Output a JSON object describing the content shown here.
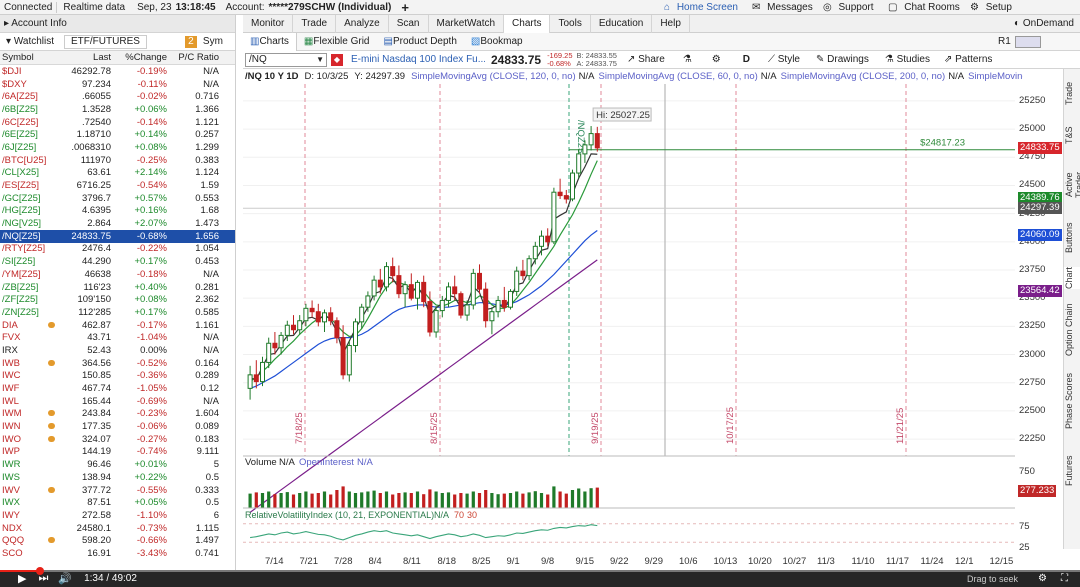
{
  "topbar": {
    "connected": "Connected",
    "realtime": "Realtime data",
    "date": "Sep, 23",
    "time": "13:18:45",
    "account_label": "Account:",
    "account": "*****279SCHW (Individual)",
    "plus": "+",
    "home_screen": "Home Screen",
    "messages": "Messages",
    "support": "Support",
    "chat_rooms": "Chat Rooms",
    "setup": "Setup",
    "ondemand": "OnDemand"
  },
  "menu": [
    "Monitor",
    "Trade",
    "Analyze",
    "Scan",
    "MarketWatch",
    "Charts",
    "Tools",
    "Education",
    "Help"
  ],
  "left": {
    "account_info": "Account Info",
    "watchlist_tab": "Watchlist",
    "etf_tab": "ETF/FUTURES",
    "sym_tab": "Sym",
    "badge": "2",
    "headers": {
      "symbol": "Symbol",
      "last": "Last",
      "change": "%Change",
      "pc": "P/C Ratio"
    },
    "rows": [
      {
        "sym": "$DJI",
        "last": "46292.78",
        "chg": "-0.19%",
        "pc": "N/A",
        "dir": "red",
        "icon": false
      },
      {
        "sym": "$DXY",
        "last": "97.234",
        "chg": "-0.11%",
        "pc": "N/A",
        "dir": "red",
        "icon": false
      },
      {
        "sym": "/6A[Z25]",
        "last": ".66055",
        "chg": "-0.02%",
        "pc": "0.716",
        "dir": "red",
        "icon": false
      },
      {
        "sym": "/6B[Z25]",
        "last": "1.3528",
        "chg": "+0.06%",
        "pc": "1.366",
        "dir": "grn",
        "icon": false
      },
      {
        "sym": "/6C[Z25]",
        "last": ".72540",
        "chg": "-0.14%",
        "pc": "1.121",
        "dir": "red",
        "icon": false
      },
      {
        "sym": "/6E[Z25]",
        "last": "1.18710",
        "chg": "+0.14%",
        "pc": "0.257",
        "dir": "grn",
        "icon": false
      },
      {
        "sym": "/6J[Z25]",
        "last": ".0068310",
        "chg": "+0.08%",
        "pc": "1.299",
        "dir": "grn",
        "icon": false
      },
      {
        "sym": "/BTC[U25]",
        "last": "111970",
        "chg": "-0.25%",
        "pc": "0.383",
        "dir": "red",
        "icon": false
      },
      {
        "sym": "/CL[X25]",
        "last": "63.61",
        "chg": "+2.14%",
        "pc": "1.124",
        "dir": "grn",
        "icon": false
      },
      {
        "sym": "/ES[Z25]",
        "last": "6716.25",
        "chg": "-0.54%",
        "pc": "1.59",
        "dir": "red",
        "icon": false
      },
      {
        "sym": "/GC[Z25]",
        "last": "3796.7",
        "chg": "+0.57%",
        "pc": "0.553",
        "dir": "grn",
        "icon": false
      },
      {
        "sym": "/HG[Z25]",
        "last": "4.6395",
        "chg": "+0.16%",
        "pc": "1.68",
        "dir": "grn",
        "icon": false
      },
      {
        "sym": "/NG[V25]",
        "last": "2.864",
        "chg": "+2.07%",
        "pc": "1.473",
        "dir": "grn",
        "icon": false
      },
      {
        "sym": "/NQ[Z25]",
        "last": "24833.75",
        "chg": "-0.68%",
        "pc": "1.656",
        "dir": "red",
        "icon": false,
        "selected": true
      },
      {
        "sym": "/RTY[Z25]",
        "last": "2476.4",
        "chg": "-0.22%",
        "pc": "1.054",
        "dir": "red",
        "icon": false
      },
      {
        "sym": "/SI[Z25]",
        "last": "44.290",
        "chg": "+0.17%",
        "pc": "0.453",
        "dir": "grn",
        "icon": false
      },
      {
        "sym": "/YM[Z25]",
        "last": "46638",
        "chg": "-0.18%",
        "pc": "N/A",
        "dir": "red",
        "icon": false
      },
      {
        "sym": "/ZB[Z25]",
        "last": "116'23",
        "chg": "+0.40%",
        "pc": "0.281",
        "dir": "grn",
        "icon": false
      },
      {
        "sym": "/ZF[Z25]",
        "last": "109'150",
        "chg": "+0.08%",
        "pc": "2.362",
        "dir": "grn",
        "icon": false
      },
      {
        "sym": "/ZN[Z25]",
        "last": "112'285",
        "chg": "+0.17%",
        "pc": "0.585",
        "dir": "grn",
        "icon": false
      },
      {
        "sym": "DIA",
        "last": "462.87",
        "chg": "-0.17%",
        "pc": "1.161",
        "dir": "red",
        "icon": true
      },
      {
        "sym": "FVX",
        "last": "43.71",
        "chg": "-1.04%",
        "pc": "N/A",
        "dir": "red",
        "icon": false
      },
      {
        "sym": "IRX",
        "last": "52.43",
        "chg": "0.00%",
        "pc": "N/A",
        "dir": "none",
        "icon": false
      },
      {
        "sym": "IWB",
        "last": "364.56",
        "chg": "-0.52%",
        "pc": "0.164",
        "dir": "red",
        "icon": true
      },
      {
        "sym": "IWC",
        "last": "150.85",
        "chg": "-0.36%",
        "pc": "0.289",
        "dir": "red",
        "icon": false
      },
      {
        "sym": "IWF",
        "last": "467.74",
        "chg": "-1.05%",
        "pc": "0.12",
        "dir": "red",
        "icon": false
      },
      {
        "sym": "IWL",
        "last": "165.44",
        "chg": "-0.69%",
        "pc": "N/A",
        "dir": "red",
        "icon": false
      },
      {
        "sym": "IWM",
        "last": "243.84",
        "chg": "-0.23%",
        "pc": "1.604",
        "dir": "red",
        "icon": true
      },
      {
        "sym": "IWN",
        "last": "177.35",
        "chg": "-0.06%",
        "pc": "0.089",
        "dir": "red",
        "icon": true
      },
      {
        "sym": "IWO",
        "last": "324.07",
        "chg": "-0.27%",
        "pc": "0.183",
        "dir": "red",
        "icon": true
      },
      {
        "sym": "IWP",
        "last": "144.19",
        "chg": "-0.74%",
        "pc": "9.111",
        "dir": "red",
        "icon": false
      },
      {
        "sym": "IWR",
        "last": "96.46",
        "chg": "+0.01%",
        "pc": "5",
        "dir": "grn",
        "icon": false
      },
      {
        "sym": "IWS",
        "last": "138.94",
        "chg": "+0.22%",
        "pc": "0.5",
        "dir": "grn",
        "icon": false
      },
      {
        "sym": "IWV",
        "last": "377.72",
        "chg": "-0.55%",
        "pc": "0.333",
        "dir": "red",
        "icon": true
      },
      {
        "sym": "IWX",
        "last": "87.51",
        "chg": "+0.05%",
        "pc": "0.5",
        "dir": "grn",
        "icon": false
      },
      {
        "sym": "IWY",
        "last": "272.58",
        "chg": "-1.10%",
        "pc": "6",
        "dir": "red",
        "icon": false
      },
      {
        "sym": "NDX",
        "last": "24580.1",
        "chg": "-0.73%",
        "pc": "1.115",
        "dir": "red",
        "icon": false
      },
      {
        "sym": "QQQ",
        "last": "598.20",
        "chg": "-0.66%",
        "pc": "1.497",
        "dir": "red",
        "icon": true
      },
      {
        "sym": "SCO",
        "last": "16.91",
        "chg": "-3.43%",
        "pc": "0.741",
        "dir": "red",
        "icon": false
      }
    ]
  },
  "chart_tabs": {
    "charts": "Charts",
    "flex": "Flexible Grid",
    "depth": "Product Depth",
    "bookmap": "Bookmap",
    "r1": "R1"
  },
  "chart_toolbar": {
    "symbol": "/NQ",
    "description": "E-mini Nasdaq 100 Index Fu...",
    "price": "24833.75",
    "chg": "-169.25",
    "chgpct": "-0.68%",
    "bid": "B: 24833.55",
    "ask": "A: 24833.75",
    "share": "Share",
    "timeframe": "D",
    "style": "Style",
    "drawings": "Drawings",
    "studies": "Studies",
    "patterns": "Patterns"
  },
  "studybar": {
    "period": "/NQ 10 Y 1D",
    "date": "D: 10/3/25",
    "yval": "Y: 24297.39",
    "sma1": "SimpleMovingAvg (CLOSE, 120, 0, no)",
    "sma1v": "N/A",
    "sma2": "SimpleMovingAvg (CLOSE, 60, 0, no)",
    "sma2v": "N/A",
    "sma3": "SimpleMovingAvg (CLOSE, 200, 0, no)",
    "sma3v": "N/A",
    "sma4": "SimpleMovingAvg ..."
  },
  "chart_data": {
    "type": "candlestick",
    "price_axis": [
      "25250",
      "25000",
      "24750",
      "24500",
      "24250",
      "24000",
      "23750",
      "23500",
      "23250",
      "23000",
      "22750",
      "22500",
      "22250"
    ],
    "ylim": [
      22100,
      25400
    ],
    "price_tags": [
      {
        "value": "24833.75",
        "color": "#d7262c"
      },
      {
        "value": "24389.76",
        "color": "#1d8a2b"
      },
      {
        "value": "24297.39",
        "color": "#555555"
      },
      {
        "value": "24060.09",
        "color": "#1e4fd6"
      },
      {
        "value": "23564.42",
        "color": "#7a1e8a"
      }
    ],
    "hline_label": "$24817.23",
    "hline_value": 24817.23,
    "hi_label": "Hi: 25027.25",
    "date_markers": [
      "7/18/25",
      "8/15/25",
      "9/19/25",
      "10/17/25",
      "11/21/25"
    ],
    "expiry_marker": "/NQZ25",
    "x_ticks": [
      "7/14",
      "7/21",
      "7/28",
      "8/4",
      "8/11",
      "8/18",
      "8/25",
      "9/1",
      "9/8",
      "9/15",
      "9/22",
      "9/29",
      "10/6",
      "10/13",
      "10/20",
      "10/27",
      "11/3",
      "11/10",
      "11/17",
      "11/24",
      "12/1",
      "12/15"
    ],
    "volume_label": "Volume",
    "volume_na": "N/A",
    "oi_label": "OpenInterest",
    "oi_na": "N/A",
    "volume_axis": "750",
    "volume_tag": "277.233",
    "rvi_label": "RelativeVolatilityIndex (10, 21, EXPONENTIAL)",
    "rvi_na": "N/A",
    "rvi_70": "70",
    "rvi_30": "30",
    "rvi_axis": [
      "75",
      "25"
    ],
    "candles": [
      [
        22700,
        22900,
        22600,
        22820
      ],
      [
        22820,
        22950,
        22700,
        22760
      ],
      [
        22760,
        22980,
        22720,
        22930
      ],
      [
        22930,
        23150,
        22880,
        23100
      ],
      [
        23100,
        23200,
        23000,
        23060
      ],
      [
        23060,
        23200,
        23000,
        23170
      ],
      [
        23170,
        23300,
        23120,
        23260
      ],
      [
        23260,
        23350,
        23180,
        23220
      ],
      [
        23220,
        23350,
        23180,
        23300
      ],
      [
        23300,
        23450,
        23250,
        23410
      ],
      [
        23410,
        23480,
        23330,
        23380
      ],
      [
        23380,
        23450,
        23250,
        23290
      ],
      [
        23290,
        23400,
        23200,
        23370
      ],
      [
        23370,
        23420,
        23260,
        23300
      ],
      [
        23300,
        23330,
        23100,
        23150
      ],
      [
        23150,
        23260,
        22780,
        22820
      ],
      [
        22820,
        23120,
        22760,
        23080
      ],
      [
        23080,
        23320,
        23020,
        23290
      ],
      [
        23290,
        23450,
        23230,
        23420
      ],
      [
        23420,
        23560,
        23380,
        23520
      ],
      [
        23520,
        23700,
        23480,
        23660
      ],
      [
        23660,
        23760,
        23540,
        23600
      ],
      [
        23600,
        23820,
        23560,
        23780
      ],
      [
        23780,
        23860,
        23640,
        23700
      ],
      [
        23700,
        23790,
        23500,
        23540
      ],
      [
        23540,
        23650,
        23420,
        23620
      ],
      [
        23620,
        23720,
        23480,
        23500
      ],
      [
        23500,
        23660,
        23400,
        23640
      ],
      [
        23640,
        23700,
        23420,
        23470
      ],
      [
        23470,
        23560,
        23160,
        23200
      ],
      [
        23200,
        23430,
        23150,
        23390
      ],
      [
        23390,
        23520,
        23330,
        23480
      ],
      [
        23480,
        23640,
        23420,
        23600
      ],
      [
        23600,
        23700,
        23480,
        23540
      ],
      [
        23540,
        23560,
        23320,
        23350
      ],
      [
        23350,
        23480,
        23300,
        23440
      ],
      [
        23440,
        23760,
        23400,
        23720
      ],
      [
        23720,
        23800,
        23540,
        23580
      ],
      [
        23580,
        23640,
        23240,
        23300
      ],
      [
        23300,
        23420,
        23180,
        23380
      ],
      [
        23380,
        23520,
        23330,
        23480
      ],
      [
        23480,
        23600,
        23380,
        23420
      ],
      [
        23420,
        23580,
        23400,
        23560
      ],
      [
        23560,
        23780,
        23520,
        23740
      ],
      [
        23740,
        23840,
        23660,
        23700
      ],
      [
        23700,
        23880,
        23660,
        23850
      ],
      [
        23850,
        24000,
        23800,
        23960
      ],
      [
        23960,
        24100,
        23880,
        24050
      ],
      [
        24050,
        24120,
        23960,
        24000
      ],
      [
        24000,
        24480,
        23980,
        24440
      ],
      [
        24440,
        24560,
        24380,
        24410
      ],
      [
        24410,
        24460,
        24340,
        24380
      ],
      [
        24380,
        24640,
        24360,
        24610
      ],
      [
        24610,
        24820,
        24560,
        24780
      ],
      [
        24780,
        24900,
        24700,
        24860
      ],
      [
        24860,
        25027,
        24810,
        24960
      ],
      [
        24960,
        25020,
        24800,
        24833
      ]
    ],
    "sma_fast": [
      22760,
      22800,
      22850,
      22900,
      22960,
      23010,
      23070,
      23120,
      23180,
      23230,
      23280,
      23320,
      23340,
      23320,
      23260,
      23200,
      23160,
      23170,
      23230,
      23320,
      23420,
      23520,
      23600,
      23650,
      23640,
      23620,
      23590,
      23570,
      23560,
      23490,
      23440,
      23430,
      23450,
      23480,
      23480,
      23460,
      23480,
      23520,
      23500,
      23440,
      23410,
      23410,
      23440,
      23500,
      23570,
      23640,
      23720,
      23800,
      23880,
      23960,
      24060,
      24150,
      24240,
      24350,
      24470,
      24600,
      24720
    ],
    "sma_mid": [
      22700,
      22720,
      22750,
      22780,
      22810,
      22850,
      22890,
      22930,
      22970,
      23010,
      23050,
      23090,
      23120,
      23140,
      23150,
      23150,
      23150,
      23160,
      23180,
      23210,
      23250,
      23290,
      23330,
      23370,
      23400,
      23420,
      23430,
      23440,
      23440,
      23430,
      23420,
      23420,
      23420,
      23430,
      23440,
      23440,
      23450,
      23460,
      23460,
      23450,
      23440,
      23440,
      23450,
      23470,
      23500,
      23530,
      23570,
      23610,
      23660,
      23710,
      23770,
      23830,
      23890,
      23950,
      24010,
      24060,
      24100
    ],
    "sma_slow": [
      21600,
      21640,
      21680,
      21720,
      21760,
      21800,
      21840,
      21880,
      21920,
      21960,
      22000,
      22040,
      22080,
      22120,
      22160,
      22200,
      22240,
      22280,
      22320,
      22360,
      22400,
      22440,
      22480,
      22520,
      22560,
      22600,
      22640,
      22680,
      22720,
      22760,
      22800,
      22840,
      22880,
      22920,
      22960,
      23000,
      23040,
      23080,
      23120,
      23160,
      23200,
      23240,
      23280,
      23320,
      23360,
      23400,
      23440,
      23480,
      23520,
      23560,
      23600,
      23640,
      23680,
      23720,
      23760,
      23800,
      23840
    ],
    "volumes": [
      0.48,
      0.52,
      0.5,
      0.55,
      0.46,
      0.5,
      0.53,
      0.45,
      0.5,
      0.55,
      0.48,
      0.5,
      0.55,
      0.45,
      0.6,
      0.72,
      0.55,
      0.5,
      0.52,
      0.55,
      0.58,
      0.5,
      0.55,
      0.45,
      0.5,
      0.52,
      0.5,
      0.55,
      0.46,
      0.62,
      0.55,
      0.5,
      0.52,
      0.45,
      0.5,
      0.48,
      0.55,
      0.5,
      0.6,
      0.5,
      0.46,
      0.48,
      0.5,
      0.55,
      0.48,
      0.52,
      0.56,
      0.5,
      0.45,
      0.72,
      0.55,
      0.48,
      0.6,
      0.65,
      0.55,
      0.66,
      0.68
    ],
    "rvi": [
      40,
      42,
      45,
      48,
      46,
      50,
      52,
      48,
      50,
      53,
      50,
      47,
      46,
      43,
      38,
      35,
      40,
      45,
      48,
      52,
      55,
      53,
      55,
      50,
      48,
      46,
      44,
      46,
      42,
      38,
      42,
      45,
      48,
      46,
      42,
      44,
      48,
      45,
      40,
      42,
      44,
      43,
      46,
      50,
      49,
      52,
      55,
      57,
      56,
      60,
      62,
      61,
      64,
      66,
      65,
      68,
      66
    ]
  },
  "right_tabs": [
    "Trade",
    "T&S",
    "Active Trader",
    "Buttons",
    "Chart",
    "Option Chain",
    "Phase Scores",
    "Futures"
  ],
  "player": {
    "time": "1:34 / 49:02",
    "overlay": "Drag to seek"
  }
}
